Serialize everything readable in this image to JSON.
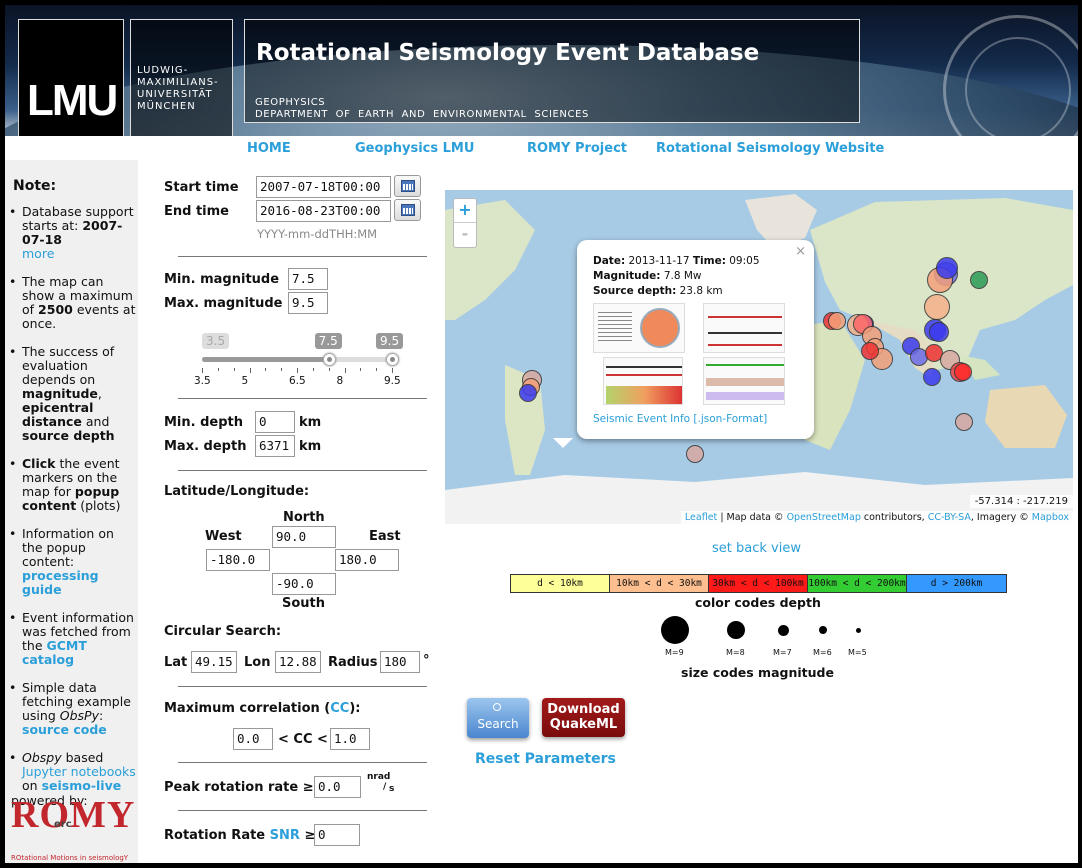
{
  "header": {
    "logo_text": "LMU",
    "university_name": "LUDWIG-\nMAXIMILIANS-\nUNIVERSITÄT\nMÜNCHEN",
    "title": "Rotational Seismology Event Database",
    "subtitle": "GEOPHYSICS\nDEPARTMENT  OF  EARTH  AND  ENVIRONMENTAL  SCIENCES"
  },
  "nav": [
    "HOME",
    "Geophysics LMU",
    "ROMY Project",
    "Rotational Seismology Website"
  ],
  "sidebar": {
    "heading": "Note:",
    "items": [
      {
        "pre": "Database support starts at:",
        "bold": "2007-07-18",
        "link": "more"
      },
      {
        "pre": "The map can show a maximum of",
        "bold": "2500",
        "post": "events at once."
      },
      {
        "pre": "The success of evaluation depends on",
        "bold1": "magnitude",
        "bold2": "epicentral distance",
        "mid": "and",
        "bold3": "source depth"
      },
      {
        "bold": "Click",
        "post": "the event markers on the map for",
        "bold2": "popup content",
        "post2": "(plots)"
      },
      {
        "pre": "Information on the popup content:",
        "link": "processing guide"
      },
      {
        "pre": "Event information was fetched from the",
        "link": "GCMT catalog"
      },
      {
        "pre": "Simple data fetching example using",
        "italic": "ObsPy",
        "link": "source code"
      },
      {
        "italic": "Obspy",
        "pre": "based",
        "link": "Jupyter notebooks",
        "mid": "on",
        "link2": "seismo-live"
      }
    ],
    "powered_by": "powered by:",
    "romy_logo": "ROMY",
    "romy_logo_sup": "erc",
    "romy_sub": "ROtational Motions in seismologY"
  },
  "form": {
    "start_label": "Start time",
    "start_value": "2007-07-18T00:00",
    "end_label": "End time",
    "end_value": "2016-08-23T00:00",
    "date_hint": "YYYY-mm-ddTHH:MM",
    "min_mag_label": "Min. magnitude",
    "min_mag_value": "7.5",
    "max_mag_label": "Max. magnitude",
    "max_mag_value": "9.5",
    "slider": {
      "min": 3.5,
      "max": 9.5,
      "low": 7.5,
      "high": 9.5,
      "low_label": "3.5",
      "handle1_label": "7.5",
      "handle2_label": "9.5",
      "ticks": [
        "3.5",
        "5",
        "6.5",
        "8",
        "9.5"
      ]
    },
    "min_depth_label": "Min. depth",
    "min_depth_value": "0",
    "max_depth_label": "Max. depth",
    "max_depth_value": "6371",
    "depth_unit": "km",
    "latlon_label": "Latitude/Longitude:",
    "north_label": "North",
    "north_value": "90.0",
    "west_label": "West",
    "west_value": "-180.0",
    "east_label": "East",
    "east_value": "180.0",
    "south_value": "-90.0",
    "south_label": "South",
    "circular_label": "Circular Search:",
    "lat_label": "Lat",
    "lat_value": "49.15",
    "lon_label": "Lon",
    "lon_value": "12.88",
    "radius_label": "Radius",
    "radius_value": "180",
    "radius_unit": "°",
    "cc_label_pre": "Maximum correlation (",
    "cc_link": "CC",
    "cc_label_post": "):",
    "cc_low": "0.0",
    "cc_mid": "< CC <",
    "cc_high": "1.0",
    "peak_label": "Peak rotation rate ≥",
    "peak_value": "0.0",
    "peak_unit_num": "nrad",
    "peak_unit_den": "s",
    "snr_label_pre": "Rotation Rate",
    "snr_link": "SNR",
    "snr_ge": "≥",
    "snr_value": "0"
  },
  "map": {
    "zoom_in": "+",
    "zoom_out": "-",
    "popup": {
      "date_label": "Date:",
      "date_value": "2013-11-17",
      "time_label": "Time:",
      "time_value": "09:05",
      "mag_label": "Magnitude:",
      "mag_value": "7.8 Mw",
      "depth_label": "Source depth:",
      "depth_value": "23.8 km",
      "link": "Seismic Event Info [.json-Format]",
      "close": "×"
    },
    "coord_readout": "-57.314 : -217.219",
    "attribution": {
      "leaflet": "Leaflet",
      "map_data": "| Map data ©",
      "osm": "OpenStreetMap",
      "contributors": "contributors,",
      "ccbysa": "CC-BY-SA",
      "imagery": ", Imagery ©",
      "mapbox": "Mapbox"
    },
    "set_back_view": "set back view"
  },
  "legend": {
    "depth_bins": [
      {
        "label": "d < 10km",
        "color": "#ffff99"
      },
      {
        "label": "10km < d < 30km",
        "color": "#fdbf8f"
      },
      {
        "label": "30km < d < 100km",
        "color": "#ff1a1a"
      },
      {
        "label": "100km < d < 200km",
        "color": "#33cc33"
      },
      {
        "label": "d > 200km",
        "color": "#3399ff"
      }
    ],
    "depth_caption": "color codes depth",
    "sizes": [
      {
        "label": "M=9",
        "d": 28
      },
      {
        "label": "M=8",
        "d": 18
      },
      {
        "label": "M=7",
        "d": 11
      },
      {
        "label": "M=6",
        "d": 8
      },
      {
        "label": "M=5",
        "d": 5
      }
    ],
    "size_caption": "size codes magnitude"
  },
  "buttons": {
    "search_icon": "search-icon",
    "search": "Search",
    "download_1": "Download",
    "download_2": "QuakeML",
    "reset": "Reset Parameters"
  }
}
